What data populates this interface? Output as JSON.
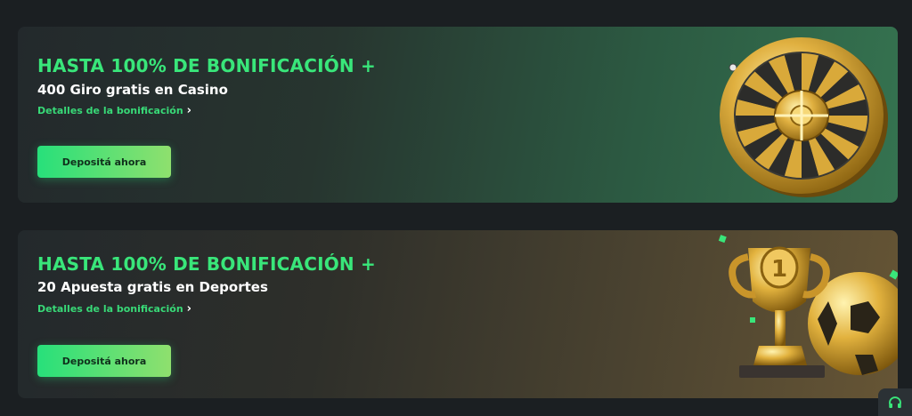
{
  "promos": [
    {
      "headline": "HASTA 100% DE BONIFICACIÓN +",
      "subline": "400 Giro gratis en Casino",
      "details_label": "Detalles de la bonificación",
      "button_label": "Depositá ahora"
    },
    {
      "headline": "HASTA 100% DE BONIFICACIÓN +",
      "subline": "20 Apuesta gratis en Deportes",
      "details_label": "Detalles de la bonificación",
      "button_label": "Depositá ahora"
    }
  ],
  "icons": {
    "details_chevron": "chevron-right-icon",
    "support": "headset-icon"
  },
  "colors": {
    "accent_green": "#39e67a",
    "button_gradient": [
      "#27e07a",
      "#8fe06e"
    ],
    "casino_card_end": "#357350",
    "sports_card_end": "#665535",
    "page_background": "#1b1f22"
  }
}
